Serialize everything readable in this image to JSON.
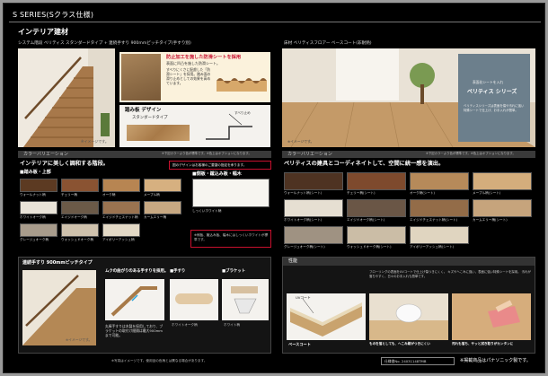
{
  "header": {
    "title": "S SERIES(Sクラス仕様)"
  },
  "section": {
    "title": "インテリア建材"
  },
  "stairs": {
    "caption": "システム階段 ベリティス スタンダードタイプ + 連続手すり 900mmピッチタイプ(手すり別)",
    "image_note": "※イメージです。",
    "sheet_title": "防止加工を施した防滑シートを採用",
    "sheet_sub": "表面に凹凸を施した防滑シート。",
    "sheet_body": "すべりにくさに配慮した「防滑シート」を採用。踏み面の滑り止めとしての効果を高めています。",
    "tread_title": "踏み板 デザイン",
    "tread_type": "スタンダードタイプ",
    "tread_dim": "すべり止め",
    "color_var": "カラーバリエーション",
    "color_note": "※下記カラーより色が標準です。※色上はオプションになります。",
    "lead": "インテリアに美しく調和する階段。",
    "group1": "■踏み板・上部",
    "swatches1": [
      "ウォールナット柄",
      "チェリー柄",
      "オーク柄",
      "メープル柄",
      "ホワイトオーク柄",
      "エイジドオーク柄",
      "エイジドチェスナット柄",
      "カームエリー柄",
      "グレージュオーク柄",
      "ウォッシュドオーク柄",
      "アイボリーアッシュ柄"
    ],
    "redbox1": "図のデザインはお客様のご要望の指定を承ります。",
    "group2": "■側板・蹴込み板・幅木",
    "swatch2": "しっくいホワイト柄",
    "side_note": "※側板、蹴込み板、幅木にはしっくいホワイトが標準です。"
  },
  "handrail": {
    "caption": "連続手すり 900mmピッチタイプ",
    "image_note": "※イメージです。",
    "bend_title": "ムクの曲がりのある手すりを採用。",
    "label_a": "■手すり",
    "label_b": "■ブラケット",
    "part_a": "ホワイトオーク柄",
    "part_b": "ホワイト柄",
    "body": "丸棒手すりは木製を採用しており、ブラケットの取付け間隔は最大900mmまで可能。"
  },
  "floor": {
    "caption": "床材 ベリティスフロアー ベースコート(非耐熱)",
    "image_note": "※イメージです。",
    "promo_small": "表面化シートを入れ",
    "promo_title": "ベリティス シリーズ",
    "promo_body": "ベリティスシリーズは表面を傷や汚れに強い特殊シートで仕上げ、お手入れが簡単。",
    "color_var": "カラーバリエーション",
    "color_note": "※下記カラーより色が標準です。※色上はオプションになります。",
    "lead": "ベリティスの建具とコーディネイトして、空間に統一感を演出。",
    "swatches": [
      "ウォールナット柄(シート)",
      "チェリー柄(シート)",
      "オーク柄(シート)",
      "メープル柄(シート)",
      "ホワイトオーク柄(シート)",
      "エイジドオーク柄(シート)",
      "エイジドチェスナット柄(シート)",
      "カームエリー柄(シート)",
      "グレージュオーク柄(シート)",
      "ウォッシュドオーク柄(シート)",
      "アイボリーアッシュ柄(シート)"
    ]
  },
  "performance": {
    "title": "性能",
    "layer": "UVコート",
    "base_title": "ベースコート",
    "base_body": "フローリングの表面をUVコートで仕上げ傷つきにくく。",
    "p2_title": "ものを落としても、へこみ跡がつきにくい",
    "p2_body": "キズやへこみに強い、表面に強い特殊シートを採用。",
    "p3_title": "汚れも落ち、サッと拭き取りがカンタンに",
    "p3_body": "汚れが落ちやすく、日々のお手入れも簡単です。"
  },
  "footer": {
    "note": "※写真はイメージです。使用品の色柄とは異なる場合があります。",
    "code": "仕様書No. 24031148TMB",
    "brand": "※掲載商品はパナソニック製です。"
  },
  "colors": {
    "accent_red": "#c8102e",
    "panel_dark": "#1a1a1a"
  }
}
